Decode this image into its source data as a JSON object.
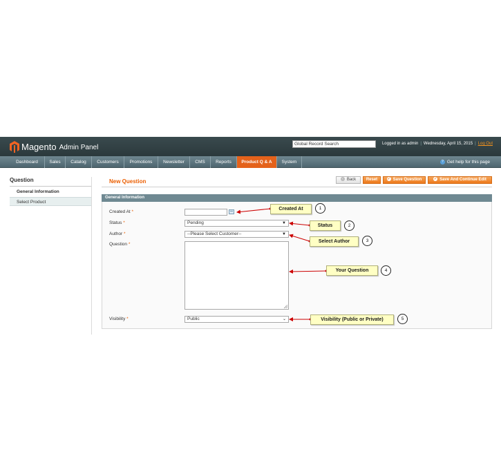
{
  "header": {
    "logo_text": "Magento",
    "panel_text": "Admin Panel",
    "search_value": "Global Record Search",
    "logged_in": "Logged in as admin",
    "date": "Wednesday, April 15, 2015",
    "logout": "Log Out"
  },
  "nav": {
    "items": [
      {
        "label": "Dashboard"
      },
      {
        "label": "Sales"
      },
      {
        "label": "Catalog"
      },
      {
        "label": "Customers"
      },
      {
        "label": "Promotions"
      },
      {
        "label": "Newsletter"
      },
      {
        "label": "CMS"
      },
      {
        "label": "Reports"
      },
      {
        "label": "Product Q & A",
        "active": true
      },
      {
        "label": "System"
      }
    ],
    "help": "Get help for this page"
  },
  "sidebar": {
    "title": "Question",
    "items": [
      {
        "label": "General Information"
      },
      {
        "label": "Select Product"
      }
    ]
  },
  "main": {
    "title": "New Question",
    "buttons": {
      "back": "Back",
      "reset": "Reset",
      "save": "Save Question",
      "save_continue": "Save And Continue Edit"
    },
    "section_title": "General Information",
    "fields": {
      "created_at": {
        "label": "Created At",
        "value": ""
      },
      "status": {
        "label": "Status",
        "value": "Pending"
      },
      "author": {
        "label": "Author",
        "value": "--Please Select Customer--"
      },
      "question": {
        "label": "Question",
        "value": ""
      },
      "visibility": {
        "label": "Visibility",
        "value": "Public"
      }
    },
    "required_mark": "*"
  },
  "callouts": [
    {
      "label": "Created At",
      "number": "1"
    },
    {
      "label": "Status",
      "number": "2"
    },
    {
      "label": "Select Author",
      "number": "3"
    },
    {
      "label": "Your Question",
      "number": "4"
    },
    {
      "label": "Visibility (Public or Private)",
      "number": "5"
    }
  ],
  "colors": {
    "accent": "#eb5e00",
    "nav_active": "#e4621b",
    "header_bg": "#2f3e42",
    "callout_bg": "#ffffc4",
    "arrow": "#cc0000"
  }
}
